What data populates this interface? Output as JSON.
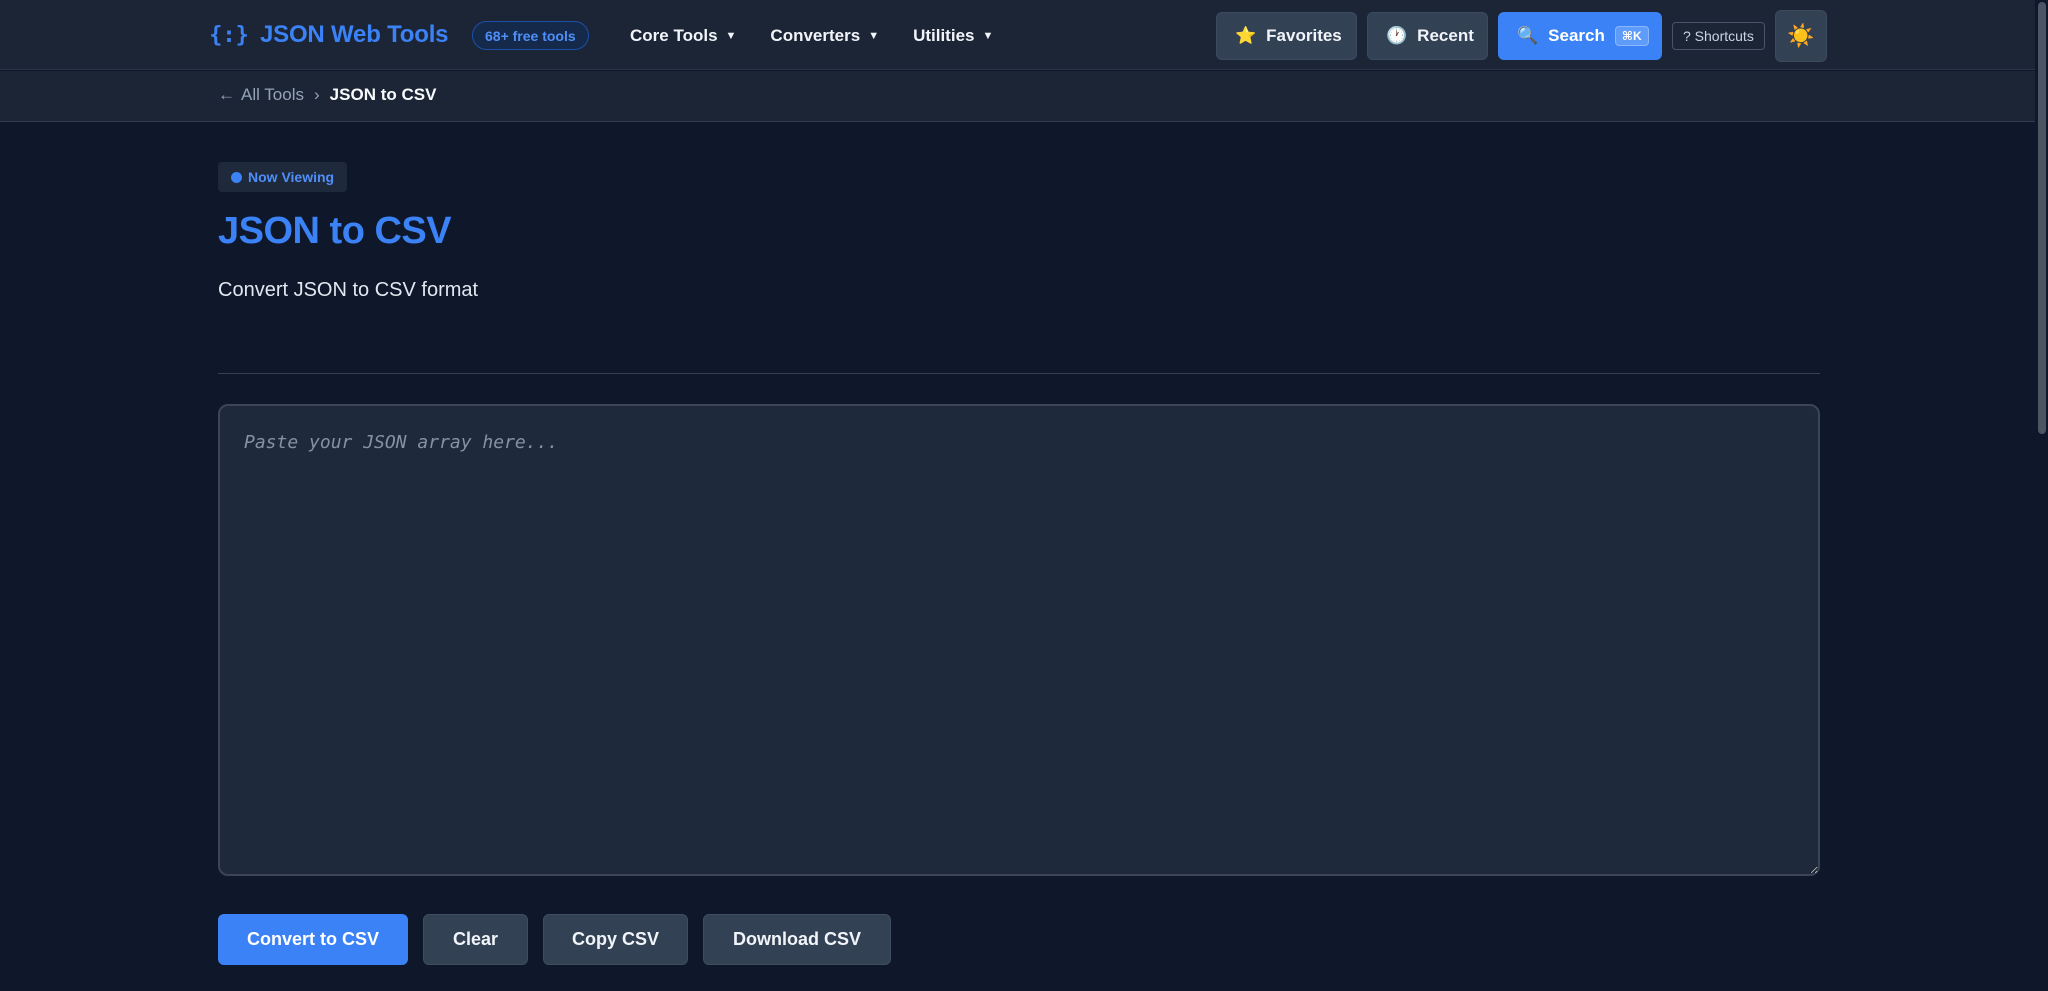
{
  "nav": {
    "brand_icon": "{:}",
    "brand_title": "JSON Web Tools",
    "tools_badge": "68+ free tools",
    "menu": [
      {
        "label": "Core Tools"
      },
      {
        "label": "Converters"
      },
      {
        "label": "Utilities"
      }
    ],
    "favorites_icon": "⭐",
    "favorites_label": "Favorites",
    "recent_icon": "🕐",
    "recent_label": "Recent",
    "search_icon": "🔍",
    "search_label": "Search",
    "search_shortcut": "⌘K",
    "shortcuts_label": "? Shortcuts",
    "theme_icon": "☀️"
  },
  "breadcrumb": {
    "back_arrow": "←",
    "back_label": "All Tools",
    "separator": "›",
    "current": "JSON to CSV"
  },
  "main": {
    "status_badge": "Now Viewing",
    "title": "JSON to CSV",
    "subtitle": "Convert JSON to CSV format",
    "input_value": "",
    "input_placeholder": "Paste your JSON array here...",
    "buttons": {
      "convert": "Convert to CSV",
      "clear": "Clear",
      "copy": "Copy CSV",
      "download": "Download CSV"
    }
  },
  "colors": {
    "accent": "#3b82f6",
    "background": "#0f172a",
    "surface": "#1e293b",
    "navbar": "#1c2536"
  }
}
